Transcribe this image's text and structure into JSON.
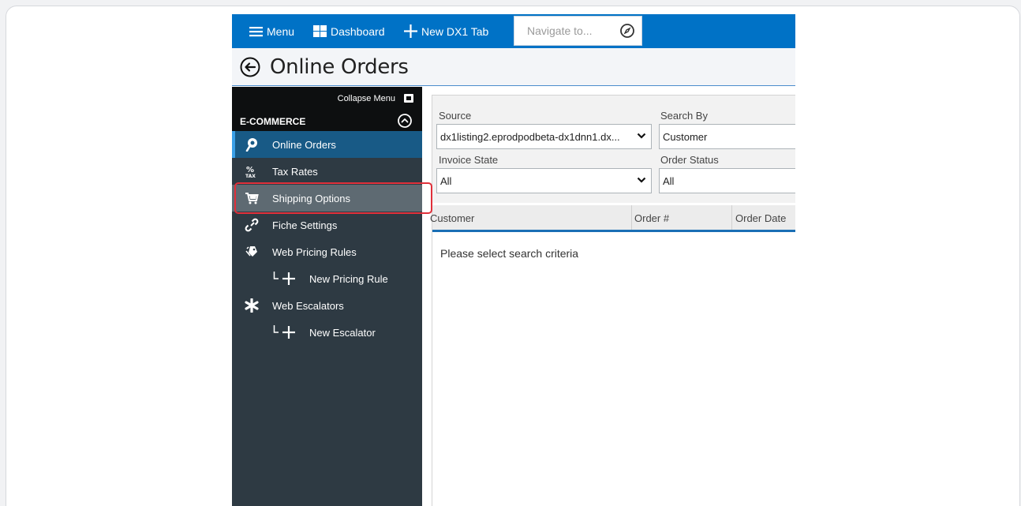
{
  "topbar": {
    "menu_label": "Menu",
    "dashboard_label": "Dashboard",
    "new_tab_label": "New DX1 Tab",
    "navigate_placeholder": "Navigate to...",
    "bg_color": "#0072c6"
  },
  "page": {
    "title": "Online Orders"
  },
  "sidebar": {
    "collapse_label": "Collapse Menu",
    "section_label": "E-COMMERCE",
    "items": [
      {
        "label": "Online Orders",
        "icon": "online-orders-icon",
        "state": "active"
      },
      {
        "label": "Tax Rates",
        "icon": "tax-icon",
        "state": "normal"
      },
      {
        "label": "Shipping Options",
        "icon": "cart-icon",
        "state": "hover"
      },
      {
        "label": "Fiche Settings",
        "icon": "link-icon",
        "state": "normal"
      },
      {
        "label": "Web Pricing Rules",
        "icon": "tags-icon",
        "state": "normal"
      },
      {
        "label": "New Pricing Rule",
        "icon": "add-icon",
        "state": "sub"
      },
      {
        "label": "Web Escalators",
        "icon": "asterisk-icon",
        "state": "normal"
      },
      {
        "label": "New Escalator",
        "icon": "add-icon",
        "state": "sub"
      }
    ]
  },
  "filters": {
    "source_label": "Source",
    "source_value": "dx1listing2.eprodpodbeta-dx1dnn1.dx...",
    "search_by_label": "Search By",
    "search_by_value": "Customer",
    "invoice_state_label": "Invoice State",
    "invoice_state_value": "All",
    "order_status_label": "Order Status",
    "order_status_value": "All"
  },
  "grid": {
    "columns": [
      "Customer",
      "Order #",
      "Order Date"
    ],
    "empty_message": "Please select search criteria"
  }
}
